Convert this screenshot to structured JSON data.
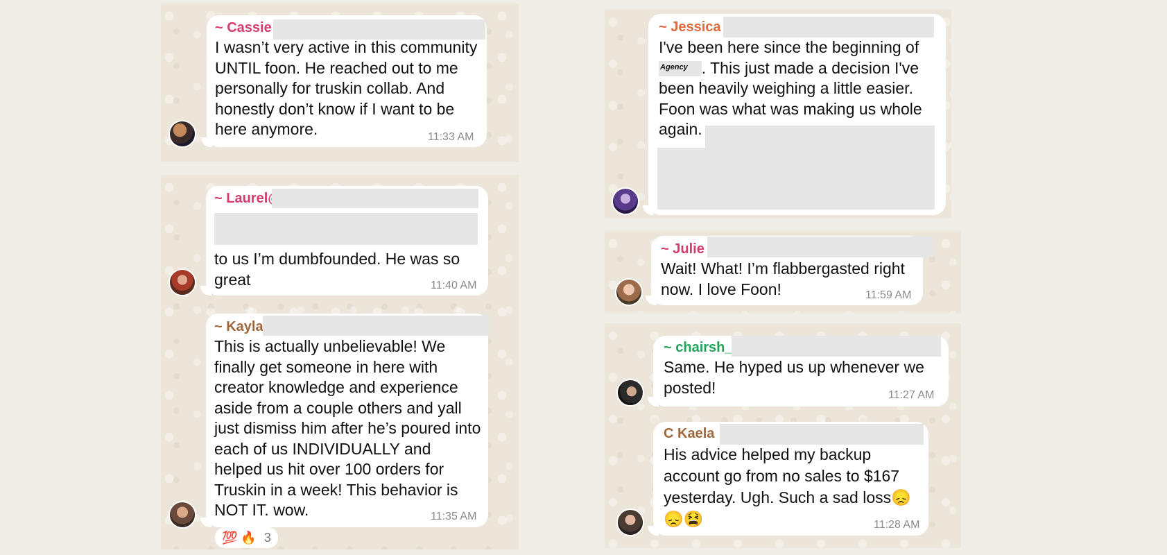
{
  "left_column": {
    "cassie": {
      "sender": "~ Cassie",
      "message": "I wasn’t very active in this community UNTIL foon. He reached out to me personally for truskin collab. And honestly don’t know if I want to be here anymore.",
      "time": "11:33 AM",
      "name_color": "#d63a6f"
    },
    "laurel": {
      "sender": "~ Laurel@",
      "message": "to us    I’m dumbfounded. He was so great",
      "time": "11:40 AM",
      "name_color": "#d63a6f"
    },
    "kayla": {
      "sender": "~ Kayla",
      "message": "This is actually unbelievable! We finally get someone in here with creator knowledge and experience aside from a couple others and yall just dismiss him after he’s poured into each of us INDIVIDUALLY and helped us hit over 100 orders for Truskin in a week! This behavior is NOT IT. wow.",
      "time": "11:35 AM",
      "name_color": "#a0673b",
      "reactions": {
        "emojis": "💯 🔥",
        "count": "3"
      }
    }
  },
  "right_column": {
    "jessica": {
      "sender": "~ Jessica",
      "message_start": "I've been here since the beginning of ",
      "agency_label": "Agency",
      "message_end": ". This just made a decision I've been heavily weighing a little easier. Foon was what was making us whole again.",
      "name_color": "#e0693a"
    },
    "julie": {
      "sender": "~ Julie",
      "message": "Wait! What! I’m flabbergasted right now. I love Foon!",
      "time": "11:59 AM",
      "name_color": "#d63a6f"
    },
    "chairsh": {
      "sender": "~ chairsh_",
      "message": "Same. He hyped us up whenever we posted!",
      "time": "11:27 AM",
      "name_color": "#1fa65a"
    },
    "ckaela": {
      "sender": "C Kaela",
      "message": "His advice helped my backup account go from no sales to $167 yesterday. Ugh. Such a sad loss😞😞😫",
      "time": "11:28 AM",
      "name_color": "#a0673b"
    }
  }
}
